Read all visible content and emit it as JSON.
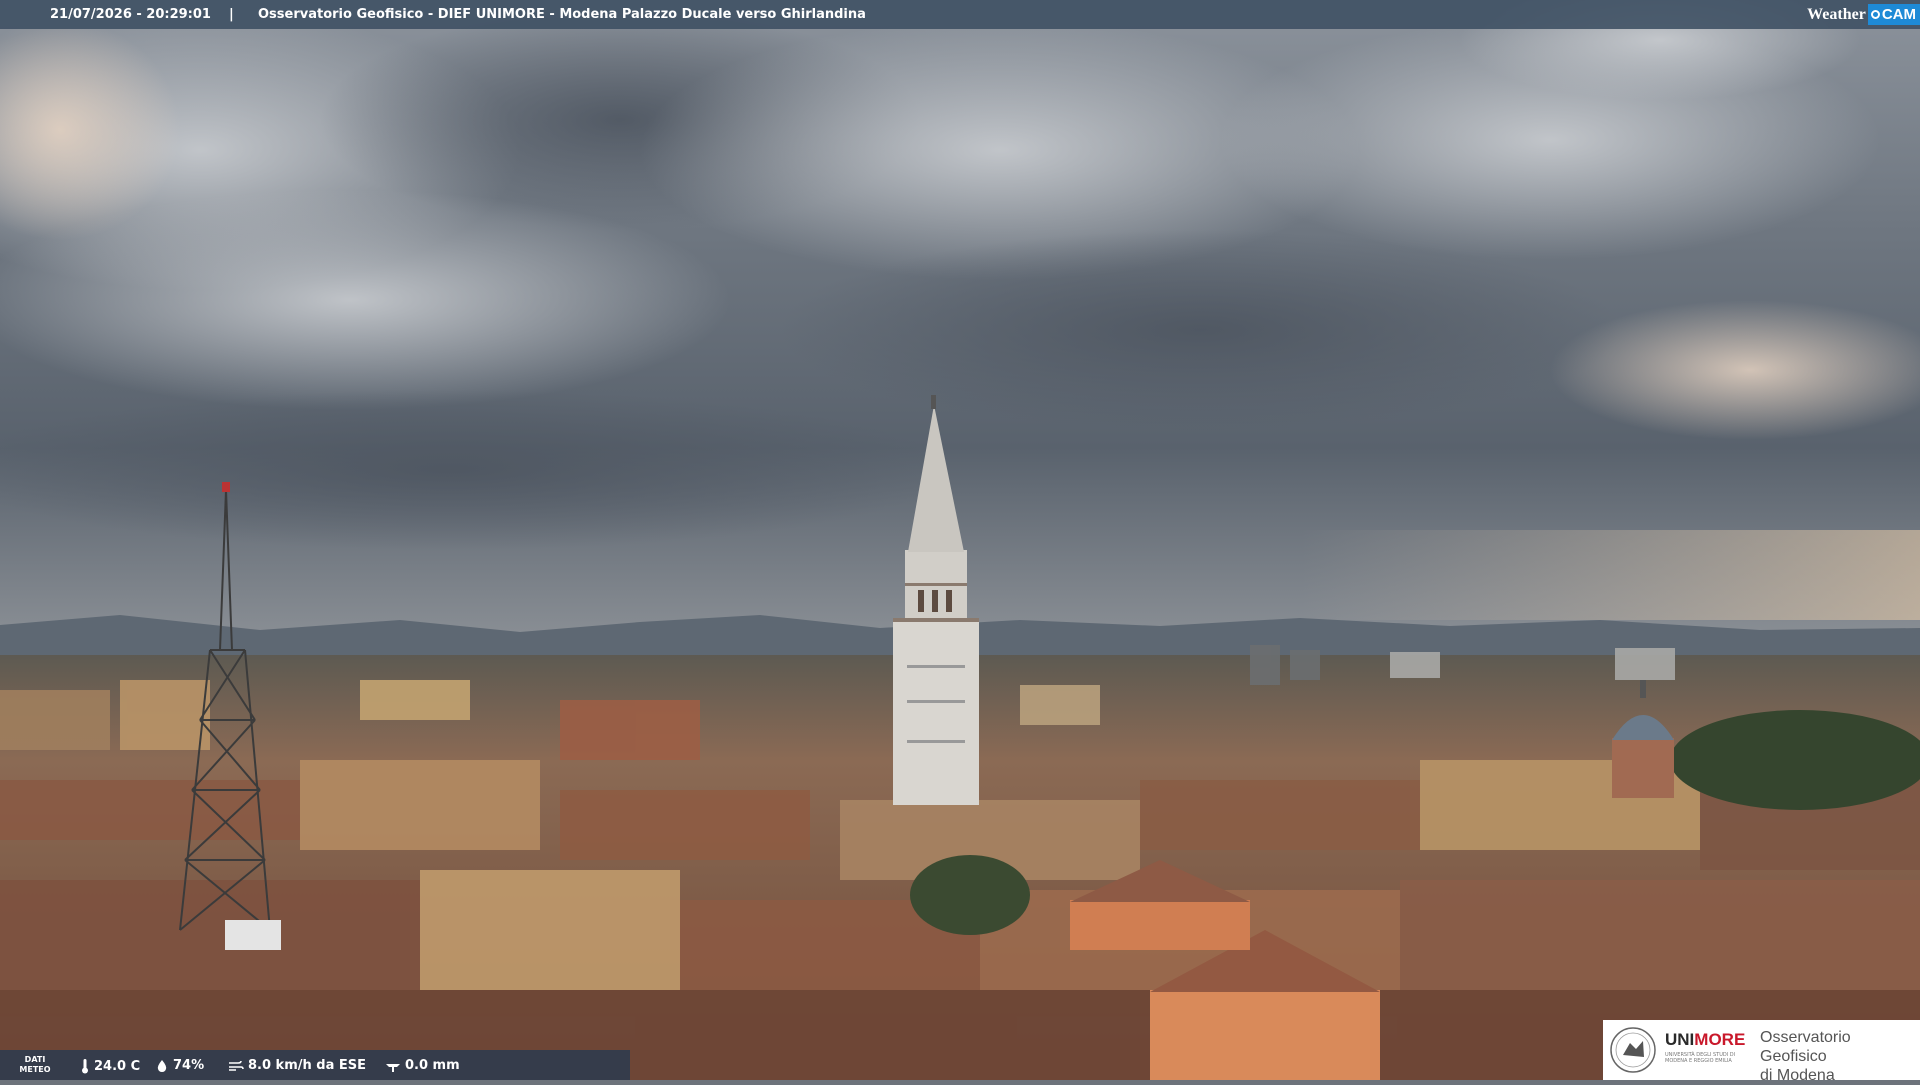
{
  "overlay": {
    "timestamp": "21/07/2026 - 20:29:01",
    "separator": "|",
    "camera_title": "Osservatorio Geofisico - DIEF UNIMORE - Modena Palazzo Ducale verso Ghirlandina",
    "brand": {
      "weather": "Weather",
      "cam": "CAM",
      "accent": "#1e8ad6"
    }
  },
  "meteo": {
    "label_line1": "DATI",
    "label_line2": "METEO",
    "temperature": "24.0 C",
    "humidity": "74%",
    "wind": "8.0 km/h da ESE",
    "rain": "0.0 mm"
  },
  "logo": {
    "uni": "UNI",
    "more": "MORE",
    "sub_line1": "UNIVERSITÀ DEGLI STUDI DI",
    "sub_line2": "MODENA E REGGIO EMILIA",
    "obs_line1": "Osservatorio Geofisico",
    "obs_line2": "di Modena",
    "brand_red": "#c9182b"
  }
}
